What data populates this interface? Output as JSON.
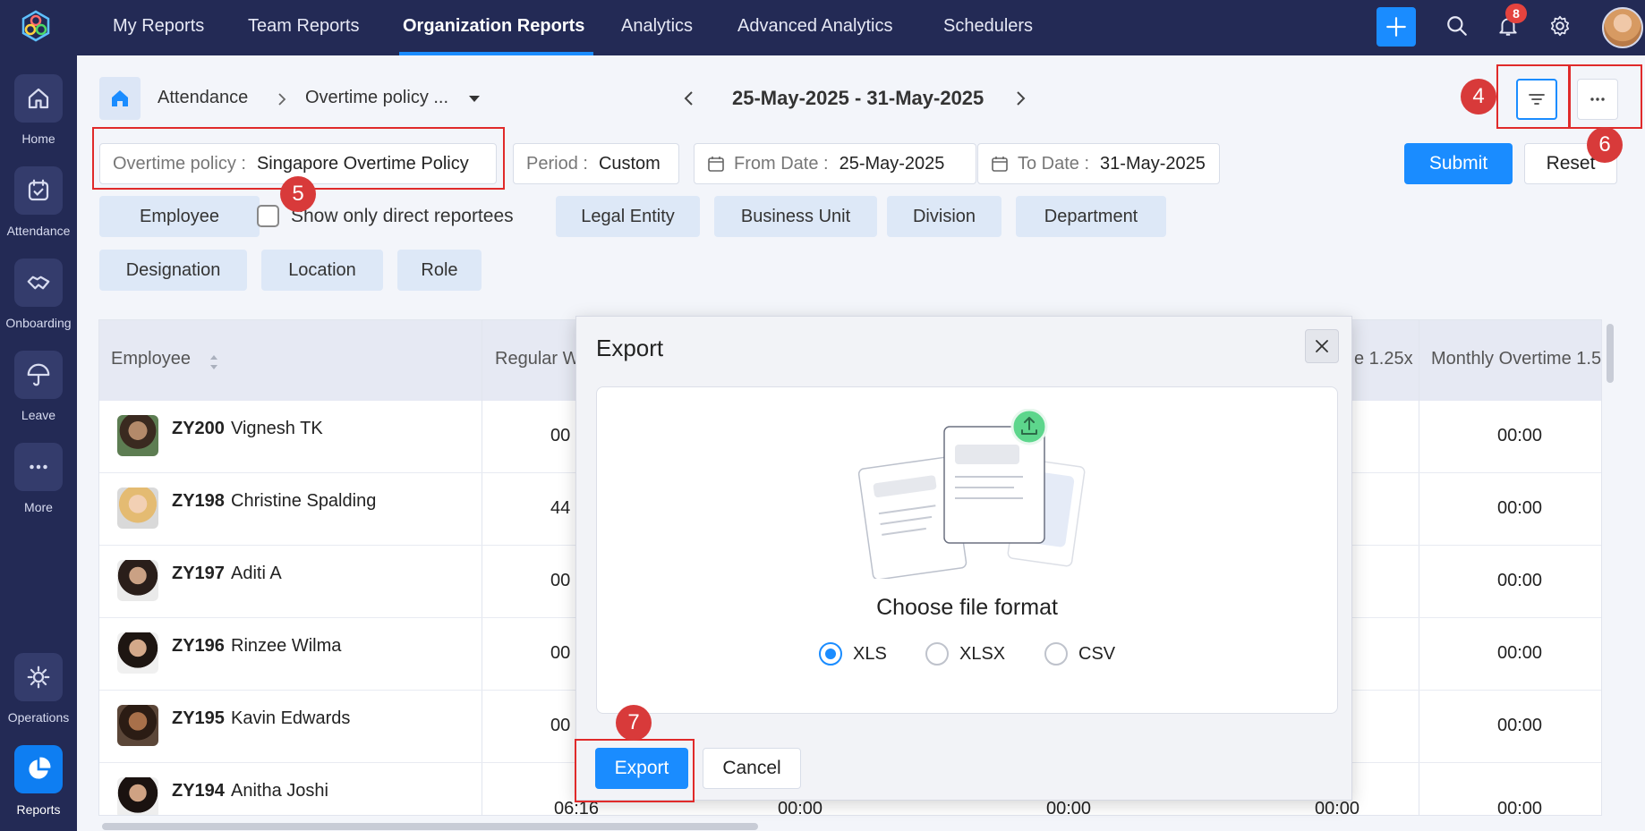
{
  "sidebar": {
    "items": [
      {
        "label": "Home",
        "icon": "home-icon"
      },
      {
        "label": "Attendance",
        "icon": "calendar-check-icon"
      },
      {
        "label": "Onboarding",
        "icon": "handshake-icon"
      },
      {
        "label": "Leave",
        "icon": "umbrella-icon"
      },
      {
        "label": "More",
        "icon": "more-dots-icon"
      },
      {
        "label": "Operations",
        "icon": "operations-gear-icon"
      },
      {
        "label": "Reports",
        "icon": "pie-chart-icon"
      }
    ],
    "active": "Reports"
  },
  "topbar": {
    "tabs": [
      "My Reports",
      "Team Reports",
      "Organization Reports",
      "Analytics",
      "Advanced Analytics",
      "Schedulers"
    ],
    "active_tab": "Organization Reports",
    "notification_count": "8"
  },
  "breadcrumb": {
    "root": "Attendance",
    "current": "Overtime policy ..."
  },
  "date_range": "25-May-2025 - 31-May-2025",
  "filters": {
    "overtime_policy": {
      "label": "Overtime policy :",
      "value": "Singapore Overtime Policy"
    },
    "period": {
      "label": "Period :",
      "value": "Custom"
    },
    "from_date": {
      "label": "From Date :",
      "value": "25-May-2025"
    },
    "to_date": {
      "label": "To Date :",
      "value": "31-May-2025"
    },
    "submit_label": "Submit",
    "reset_label": "Reset",
    "chips_row1": [
      "Employee",
      "Legal Entity",
      "Business Unit",
      "Division",
      "Department"
    ],
    "chips_row2": [
      "Designation",
      "Location",
      "Role"
    ],
    "direct_reportees_label": "Show only direct reportees"
  },
  "annotations": {
    "a4": "4",
    "a5": "5",
    "a6": "6",
    "a7": "7"
  },
  "table": {
    "headers": {
      "employee": "Employee",
      "regular": "Regular W",
      "ot125": "e 1.25x",
      "monthly": "Monthly Overtime 1.5"
    },
    "rows": [
      {
        "id": "ZY200",
        "name": "Vignesh TK",
        "regular": "00",
        "monthly": "00:00"
      },
      {
        "id": "ZY198",
        "name": "Christine Spalding",
        "regular": "44",
        "monthly": "00:00"
      },
      {
        "id": "ZY197",
        "name": "Aditi A",
        "regular": "00",
        "monthly": "00:00"
      },
      {
        "id": "ZY196",
        "name": "Rinzee Wilma",
        "regular": "00",
        "monthly": "00:00"
      },
      {
        "id": "ZY195",
        "name": "Kavin Edwards",
        "regular": "00",
        "monthly": "00:00"
      },
      {
        "id": "ZY194",
        "name": "Anitha Joshi",
        "regular": "06:16",
        "c2": "00:00",
        "c3": "00:00",
        "c4": "00:00",
        "monthly": "00:00"
      }
    ]
  },
  "modal": {
    "title": "Export",
    "subtitle": "Choose file format",
    "formats": [
      "XLS",
      "XLSX",
      "CSV"
    ],
    "selected_format": "XLS",
    "export_label": "Export",
    "cancel_label": "Cancel"
  },
  "colors": {
    "nav_bg": "#232a55",
    "accent": "#1a8cff",
    "annotation_red": "#d83a3a"
  }
}
